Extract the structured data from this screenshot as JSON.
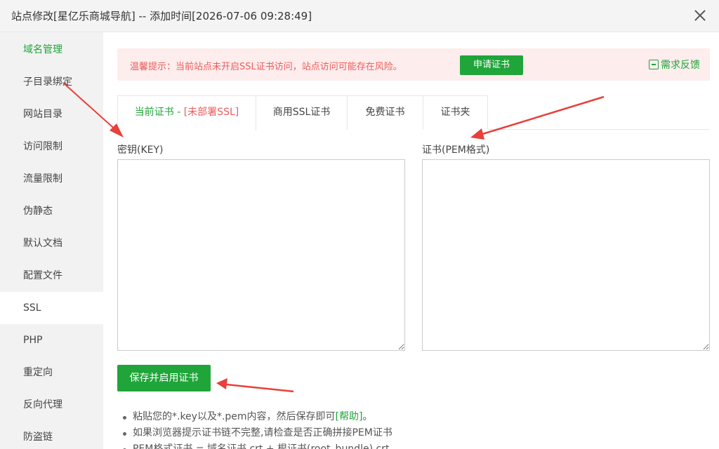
{
  "window": {
    "title": "站点修改[星亿乐商城导航] -- 添加时间[2026-07-06 09:28:49]"
  },
  "sidebar": {
    "items": [
      {
        "label": "域名管理"
      },
      {
        "label": "子目录绑定"
      },
      {
        "label": "网站目录"
      },
      {
        "label": "访问限制"
      },
      {
        "label": "流量限制"
      },
      {
        "label": "伪静态"
      },
      {
        "label": "默认文档"
      },
      {
        "label": "配置文件"
      },
      {
        "label": "SSL"
      },
      {
        "label": "PHP"
      },
      {
        "label": "重定向"
      },
      {
        "label": "反向代理"
      },
      {
        "label": "防盗链"
      }
    ]
  },
  "notice": {
    "text": "温馨提示：当前站点未开启SSL证书访问，站点访问可能存在风险。",
    "apply_button": "申请证书",
    "feedback": "需求反馈"
  },
  "tabs": {
    "current_prefix": "当前证书 - ",
    "current_status": "[未部署SSL]",
    "items": [
      {
        "label": "商用SSL证书"
      },
      {
        "label": "免费证书"
      },
      {
        "label": "证书夹"
      }
    ]
  },
  "form": {
    "key_label": "密钥(KEY)",
    "key_value": "",
    "cert_label": "证书(PEM格式)",
    "cert_value": "",
    "save_button": "保存并启用证书"
  },
  "tips": {
    "tip1_text": "粘贴您的*.key以及*.pem内容，然后保存即可",
    "tip1_link": "[帮助]",
    "tip1_end": "。",
    "tip2": "如果浏览器提示证书链不完整,请检查是否正确拼接PEM证书",
    "tip3": "PEM格式证书 = 域名证书.crt + 根证书(root_bundle).crt"
  },
  "colors": {
    "accent": "#20a53a",
    "warning": "#ef5b5b",
    "annotation_arrow": "#e8403a"
  }
}
